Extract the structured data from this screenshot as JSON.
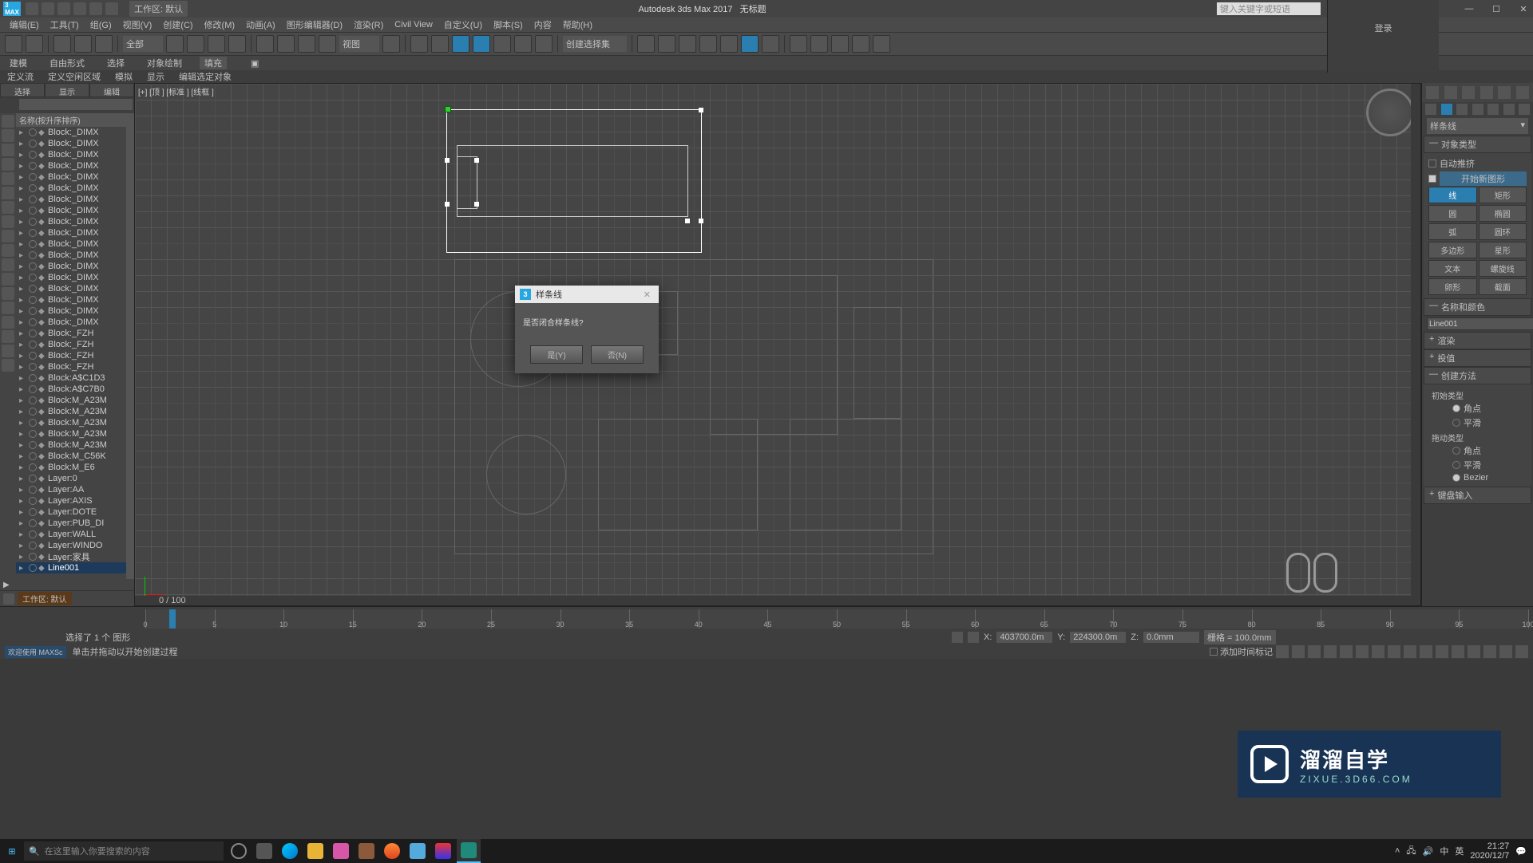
{
  "title": {
    "app": "Autodesk 3ds Max 2017",
    "doc": "无标题"
  },
  "workspace_label": "工作区: 默认",
  "search_placeholder": "键入关键字或短语",
  "login_label": "登录",
  "menu": [
    "编辑(E)",
    "工具(T)",
    "组(G)",
    "视图(V)",
    "创建(C)",
    "修改(M)",
    "动画(A)",
    "图形编辑器(D)",
    "渲染(R)",
    "Civil View",
    "自定义(U)",
    "脚本(S)",
    "内容",
    "帮助(H)"
  ],
  "toolbar_set_label": "全部",
  "toolbar_view_dd": "视图",
  "toolbar_selset": "创建选择集",
  "ribbon_tabs": [
    "建模",
    "自由形式",
    "选择",
    "对象绘制",
    "填充"
  ],
  "ribbon2": [
    "定义流",
    "定义空闲区域",
    "模拟",
    "显示",
    "编辑选定对象"
  ],
  "outliner": {
    "tabs": [
      "选择",
      "显示",
      "编辑"
    ],
    "header": "名称(按升序排序)",
    "items": [
      "Block:_DIMX",
      "Block:_DIMX",
      "Block:_DIMX",
      "Block:_DIMX",
      "Block:_DIMX",
      "Block:_DIMX",
      "Block:_DIMX",
      "Block:_DIMX",
      "Block:_DIMX",
      "Block:_DIMX",
      "Block:_DIMX",
      "Block:_DIMX",
      "Block:_DIMX",
      "Block:_DIMX",
      "Block:_DIMX",
      "Block:_DIMX",
      "Block:_DIMX",
      "Block:_DIMX",
      "Block:_FZH",
      "Block:_FZH",
      "Block:_FZH",
      "Block:_FZH",
      "Block:A$C1D3",
      "Block:A$C7B0",
      "Block:M_A23M",
      "Block:M_A23M",
      "Block:M_A23M",
      "Block:M_A23M",
      "Block:M_A23M",
      "Block:M_C56K",
      "Block:M_E6",
      "Layer:0",
      "Layer:AA",
      "Layer:AXIS",
      "Layer:DOTE",
      "Layer:PUB_DI",
      "Layer:WALL",
      "Layer:WINDO",
      "Layer:家具",
      "Line001"
    ],
    "selected_index": 39,
    "workspace_badge": "工作区: 默认"
  },
  "viewport": {
    "label": "[+] [顶 ] [标准 ] [线框 ]",
    "frame_counter": "0 / 100",
    "timeline_ticks": [
      0,
      5,
      10,
      15,
      20,
      25,
      30,
      35,
      40,
      45,
      50,
      55,
      60,
      65,
      70,
      75,
      80,
      85,
      90,
      95,
      100
    ]
  },
  "command": {
    "dropdown": "样条线",
    "obj_type_head": "对象类型",
    "autogrid": "自动推挤",
    "start_new": "开始新图形",
    "buttons": [
      "线",
      "矩形",
      "圆",
      "椭圆",
      "弧",
      "圆环",
      "多边形",
      "星形",
      "文本",
      "螺旋线",
      "卵形",
      "截面"
    ],
    "active_btn_index": 0,
    "name_color_head": "名称和颜色",
    "name_value": "Line001",
    "rollouts": [
      "渲染",
      "投值",
      "创建方法",
      "键盘输入"
    ],
    "create_method": {
      "initial_head": "初始类型",
      "initial_opts": [
        "角点",
        "平滑"
      ],
      "initial_sel": 0,
      "drag_head": "拖动类型",
      "drag_opts": [
        "角点",
        "平滑",
        "Bezier"
      ],
      "drag_sel": 2
    }
  },
  "dialog": {
    "title": "样条线",
    "message": "是否闭合样条线?",
    "yes": "是(Y)",
    "no": "否(N)"
  },
  "status": {
    "sel_info": "选择了 1 个 图形",
    "welcome": "欢迎使用 MAXSc",
    "hint": "单击并拖动以开始创建过程",
    "x_lbl": "X:",
    "x_val": "403700.0m",
    "y_lbl": "Y:",
    "y_val": "224300.0m",
    "z_lbl": "Z:",
    "z_val": "0.0mm",
    "grid_lbl": "栅格 = 100.0mm",
    "time_tag": "添加时间标记"
  },
  "taskbar": {
    "search_ph": "在这里输入你要搜索的内容",
    "ime": "英",
    "ime2": "中",
    "time": "21:27",
    "date": "2020/12/7"
  },
  "watermark": {
    "big": "溜溜自学",
    "small": "ZIXUE.3D66.COM"
  }
}
